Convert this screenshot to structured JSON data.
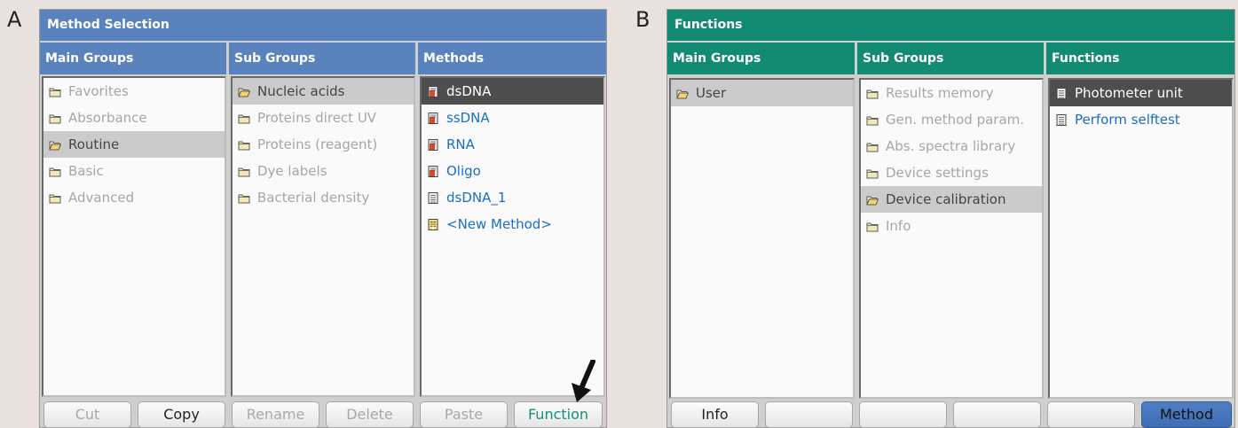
{
  "colors": {
    "blue_header": "#5a82bd",
    "green_header": "#138a72",
    "link": "#1a6fc4",
    "function_text": "#179078"
  },
  "panelA": {
    "letter": "A",
    "title": "Method Selection",
    "columns": {
      "main": "Main Groups",
      "sub": "Sub Groups",
      "methods": "Methods"
    },
    "main_groups": [
      "Favorites",
      "Absorbance",
      "Routine",
      "Basic",
      "Advanced"
    ],
    "sub_groups": [
      "Nucleic acids",
      "Proteins direct UV",
      "Proteins (reagent)",
      "Dye labels",
      "Bacterial density"
    ],
    "methods": [
      "dsDNA",
      "ssDNA",
      "RNA",
      "Oligo",
      "dsDNA_1",
      "<New Method>"
    ],
    "buttons": {
      "cut": "Cut",
      "copy": "Copy",
      "rename": "Rename",
      "delete": "Delete",
      "paste": "Paste",
      "function": "Function"
    }
  },
  "panelB": {
    "letter": "B",
    "title": "Functions",
    "columns": {
      "main": "Main Groups",
      "sub": "Sub Groups",
      "functions": "Functions"
    },
    "main_groups": [
      "User"
    ],
    "sub_groups": [
      "Results memory",
      "Gen. method param.",
      "Abs. spectra library",
      "Device settings",
      "Device calibration",
      "Info"
    ],
    "functions": [
      "Photometer unit",
      "Perform selftest"
    ],
    "buttons": {
      "info": "Info",
      "b2": "",
      "b3": "",
      "b4": "",
      "b5": "",
      "method": "Method"
    }
  }
}
